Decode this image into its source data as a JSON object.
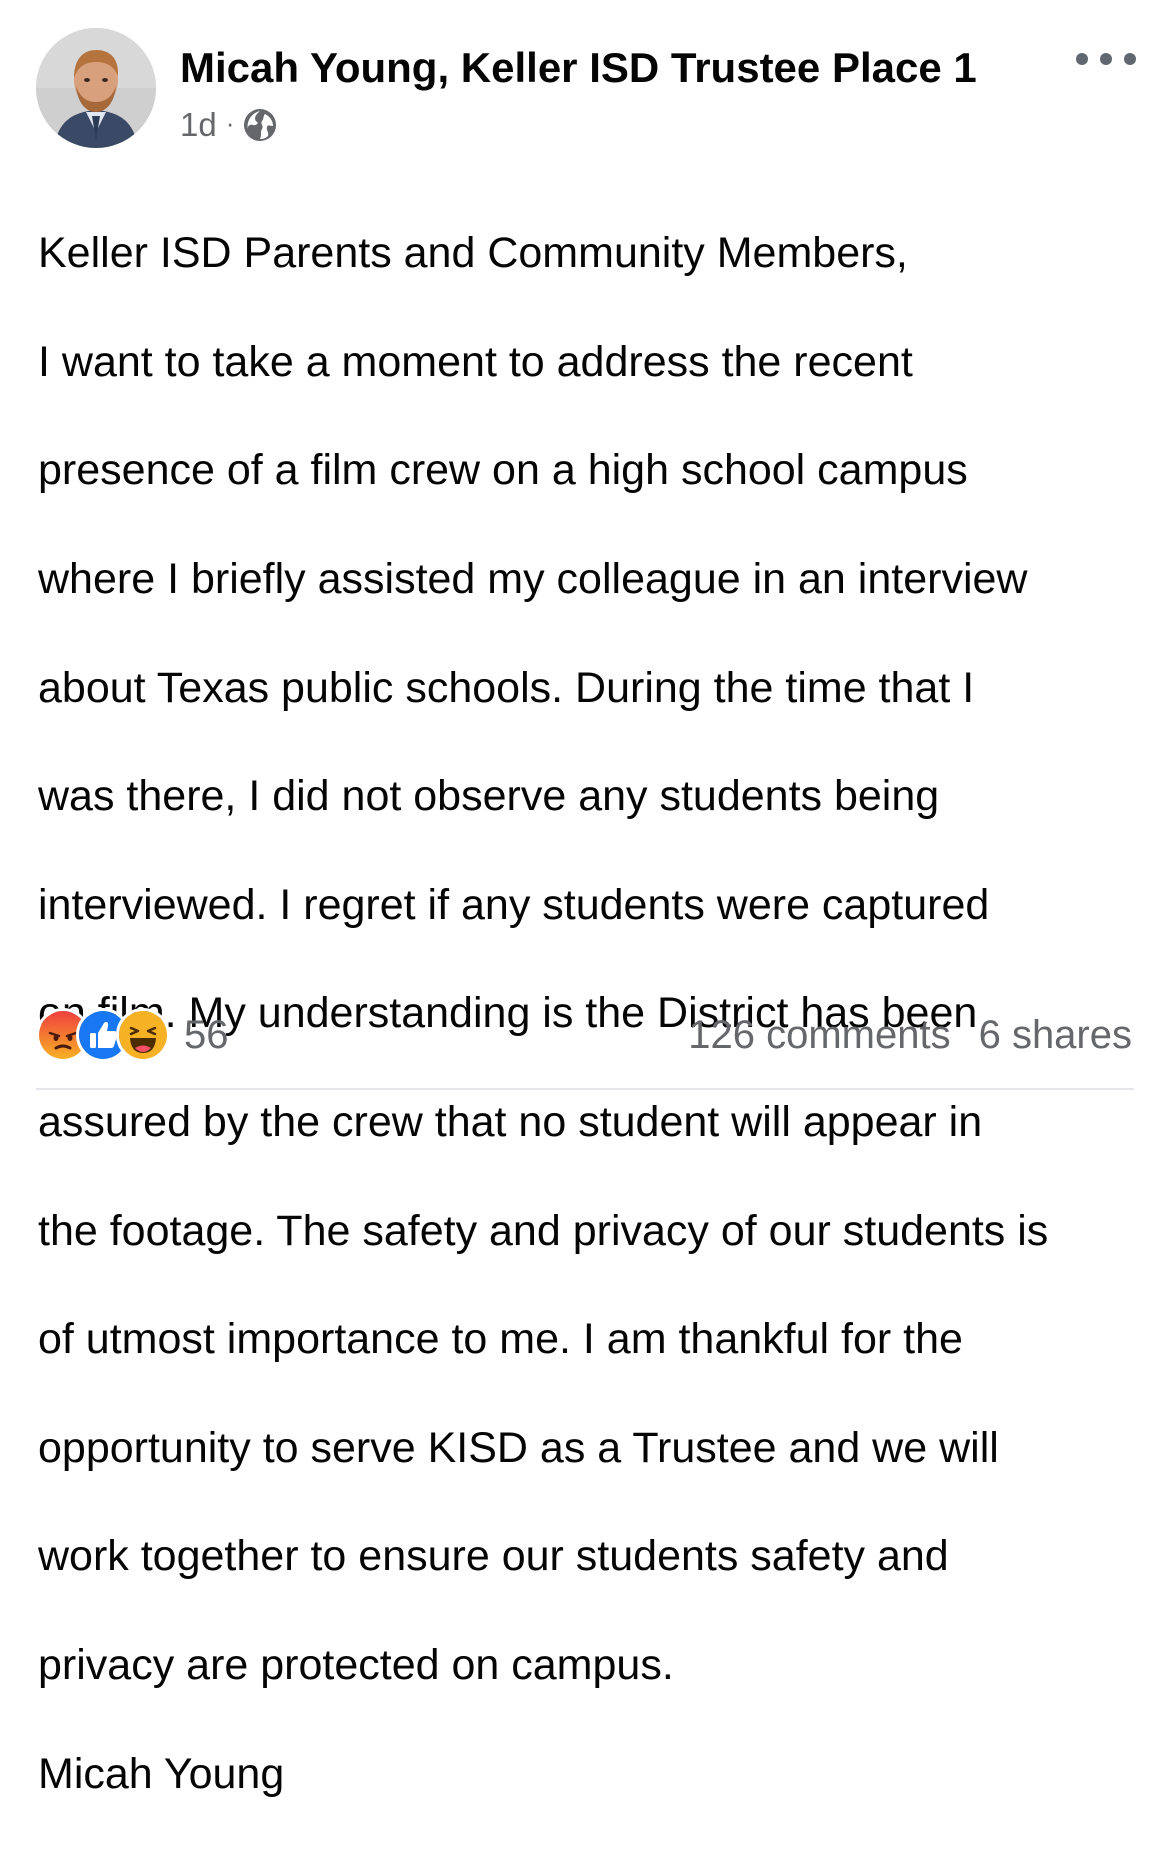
{
  "post": {
    "author_name": "Micah Young, Keller ISD Trustee Place 1",
    "timestamp": "1d",
    "separator": "·",
    "audience_icon": "globe-icon",
    "more_icon": "more-options-icon",
    "body_lines": [
      "Keller ISD Parents and Community Members,",
      "I want to take a moment to address the recent",
      "presence of a film crew on a high school campus",
      "where I briefly assisted my colleague in an interview",
      "about Texas public schools.  During the time that I",
      "was there, I did not observe any students being",
      "interviewed.  I regret if any students were captured",
      "on film.  My understanding is the District has been",
      "assured by the crew that no student will appear in",
      "the footage. The safety and privacy of our students is",
      "of utmost importance to me. I am thankful for the",
      "opportunity to serve KISD as a Trustee and we will",
      "work together to ensure our students safety and",
      "privacy are protected on campus.",
      "Micah Young"
    ]
  },
  "footer": {
    "reaction_icons": [
      "angry-reaction-icon",
      "like-reaction-icon",
      "haha-reaction-icon"
    ],
    "reaction_count": "56",
    "comments": "126 comments",
    "shares": "6 shares"
  },
  "colors": {
    "text": "#050505",
    "secondary_text": "#65676b",
    "like_blue": "#1877f2",
    "angry_orange": "#e9710f",
    "haha_yellow": "#f7b125"
  }
}
